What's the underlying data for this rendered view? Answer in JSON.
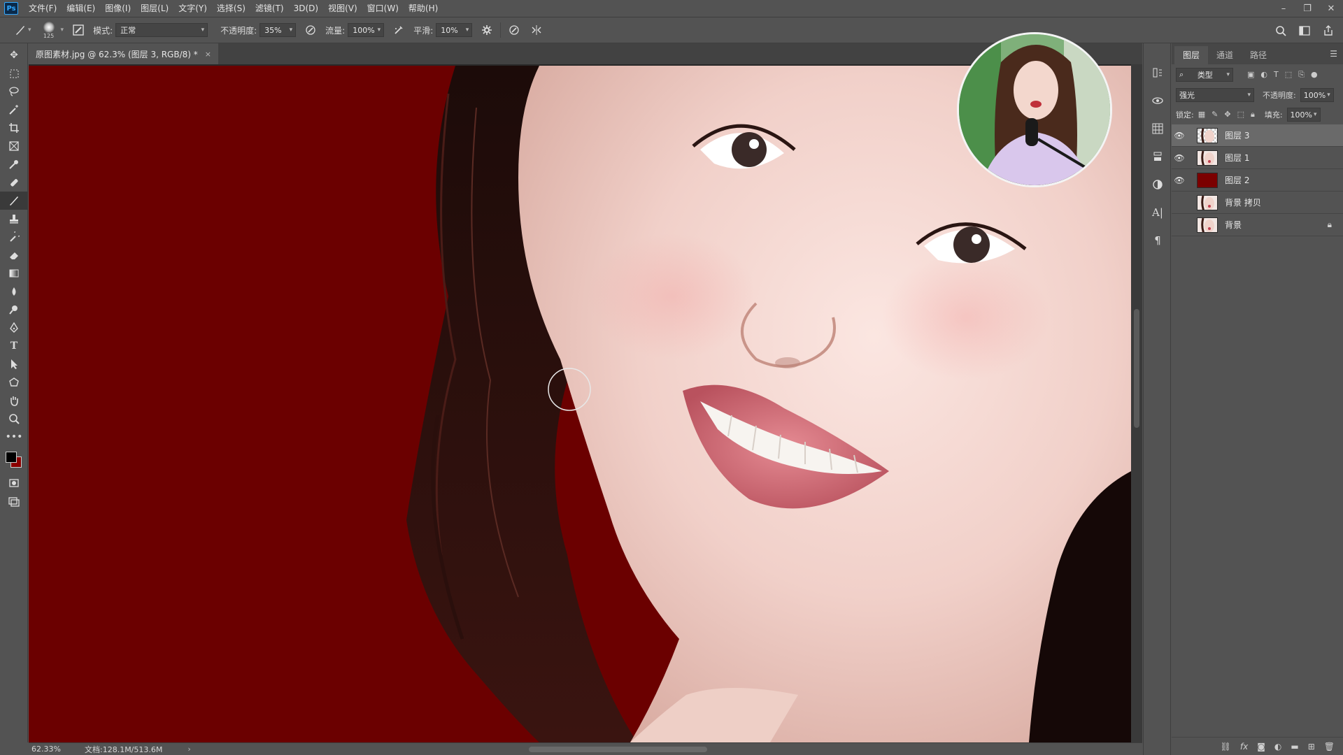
{
  "app": {
    "logo": "Ps"
  },
  "menu": [
    "文件(F)",
    "编辑(E)",
    "图像(I)",
    "图层(L)",
    "文字(Y)",
    "选择(S)",
    "滤镜(T)",
    "3D(D)",
    "视图(V)",
    "窗口(W)",
    "帮助(H)"
  ],
  "window_controls": {
    "minimize": "–",
    "restore": "❐",
    "close": "✕"
  },
  "options": {
    "brush_size": "125",
    "mode_label": "模式:",
    "mode_value": "正常",
    "opacity_label": "不透明度:",
    "opacity_value": "35%",
    "flow_label": "流量:",
    "flow_value": "100%",
    "smoothing_label": "平滑:",
    "smoothing_value": "10%"
  },
  "document": {
    "tab_title": "原图素材.jpg @ 62.3% (图层 3, RGB/8) *",
    "close": "×"
  },
  "status": {
    "zoom": "62.33%",
    "doc_info": "文档:128.1M/513.6M",
    "arrow": "›"
  },
  "layers_panel": {
    "tabs": [
      "图层",
      "通道",
      "路径"
    ],
    "filter_kind": "类型",
    "blend_mode": "强光",
    "opacity_label": "不透明度:",
    "opacity_value": "100%",
    "lock_label": "锁定:",
    "fill_label": "填充:",
    "fill_value": "100%",
    "layers": [
      {
        "name": "图层 3",
        "visible": true,
        "active": true,
        "thumb": "face-mask"
      },
      {
        "name": "图层 1",
        "visible": true,
        "active": false,
        "thumb": "face"
      },
      {
        "name": "图层 2",
        "visible": true,
        "active": false,
        "thumb": "#7b0000"
      },
      {
        "name": "背景 拷贝",
        "visible": false,
        "active": false,
        "thumb": "face"
      },
      {
        "name": "背景",
        "visible": false,
        "active": false,
        "thumb": "face",
        "locked": true
      }
    ]
  },
  "colors": {
    "canvas_red": "#6b0000",
    "foreground": "#000000",
    "background": "#8b0000"
  }
}
